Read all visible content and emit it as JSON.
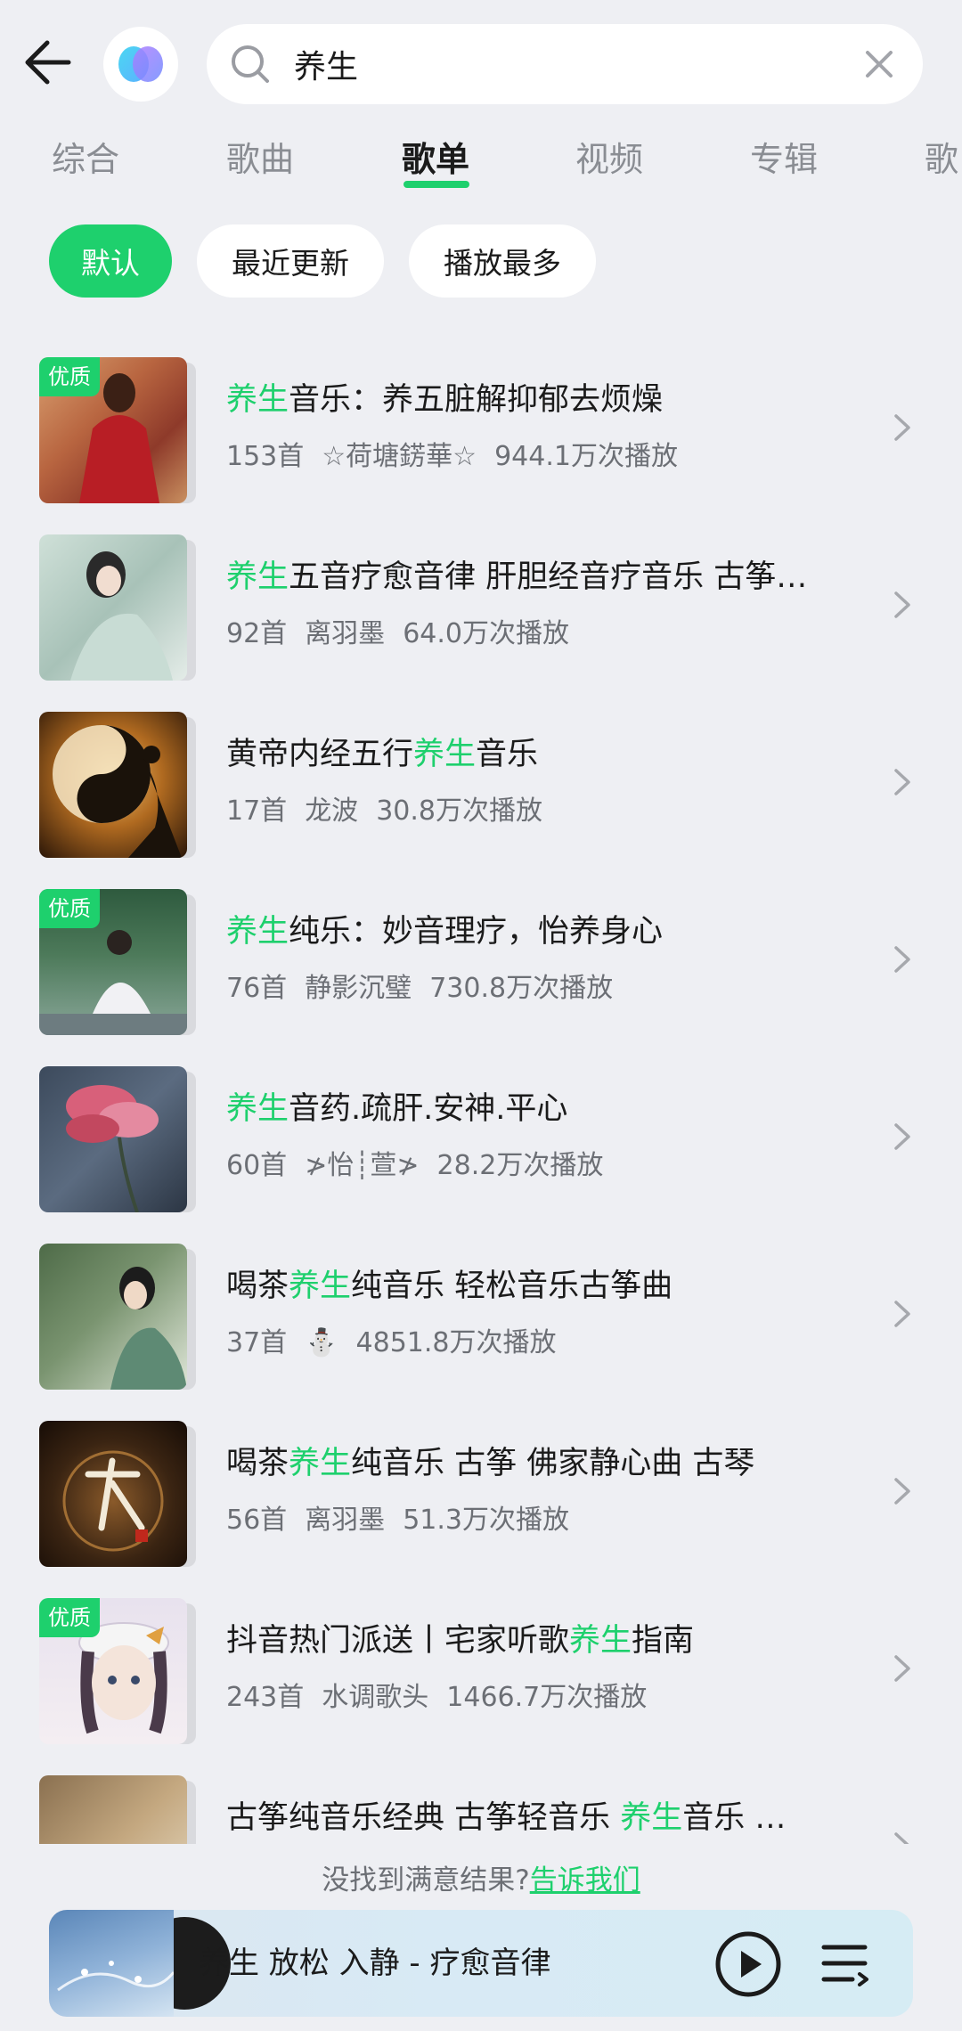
{
  "search": {
    "query": "养生"
  },
  "tabs": [
    {
      "label": "综合"
    },
    {
      "label": "歌曲"
    },
    {
      "label": "歌单"
    },
    {
      "label": "视频"
    },
    {
      "label": "专辑"
    },
    {
      "label": "歌"
    }
  ],
  "filters": [
    {
      "label": "默认"
    },
    {
      "label": "最近更新"
    },
    {
      "label": "播放最多"
    }
  ],
  "playlists": [
    {
      "title_pre": "",
      "title_hl": "养生",
      "title_post": "音乐：养五脏解抑郁去烦燥",
      "count": "153首",
      "creator": "☆荷塘錺華☆",
      "plays": "944.1万次播放",
      "badge": "优质"
    },
    {
      "title_pre": "",
      "title_hl": "养生",
      "title_post": "五音疗愈音律 肝胆经音疗音乐 古筝…",
      "count": "92首",
      "creator": "离羽墨",
      "plays": "64.0万次播放",
      "badge": ""
    },
    {
      "title_pre": "黄帝内经五行",
      "title_hl": "养生",
      "title_post": "音乐",
      "count": "17首",
      "creator": "龙波",
      "plays": "30.8万次播放",
      "badge": ""
    },
    {
      "title_pre": "",
      "title_hl": "养生",
      "title_post": "纯乐：妙音理疗，怡养身心",
      "count": "76首",
      "creator": "静影沉璧",
      "plays": "730.8万次播放",
      "badge": "优质"
    },
    {
      "title_pre": "",
      "title_hl": "养生",
      "title_post": "音药.疏肝.安神.平心",
      "count": "60首",
      "creator": "≯怡┊萱≯",
      "plays": "28.2万次播放",
      "badge": ""
    },
    {
      "title_pre": "喝茶",
      "title_hl": "养生",
      "title_post": "纯音乐 轻松音乐古筝曲",
      "count": "37首",
      "creator": "⛄",
      "plays": "4851.8万次播放",
      "badge": ""
    },
    {
      "title_pre": "喝茶",
      "title_hl": "养生",
      "title_post": "纯音乐 古筝 佛家静心曲 古琴",
      "count": "56首",
      "creator": "离羽墨",
      "plays": "51.3万次播放",
      "badge": ""
    },
    {
      "title_pre": "抖音热门派送丨宅家听歌",
      "title_hl": "养生",
      "title_post": "指南",
      "count": "243首",
      "creator": "水调歌头",
      "plays": "1466.7万次播放",
      "badge": "优质"
    },
    {
      "title_pre": "古筝纯音乐经典 古筝轻音乐 ",
      "title_hl": "养生",
      "title_post": "音乐 …",
      "count": "",
      "creator": "",
      "plays": "",
      "badge": ""
    }
  ],
  "feedback": {
    "text": "没找到满意结果?",
    "link": "告诉我们"
  },
  "player": {
    "title": "养生 放松 入静 - 疗愈音律"
  },
  "colors": {
    "accent": "#1ed06d",
    "background": "#eeeff3"
  },
  "icons": [
    "back-arrow-icon",
    "app-logo-icon",
    "search-icon",
    "close-icon",
    "chevron-right-icon",
    "play-icon",
    "playlist-icon"
  ]
}
